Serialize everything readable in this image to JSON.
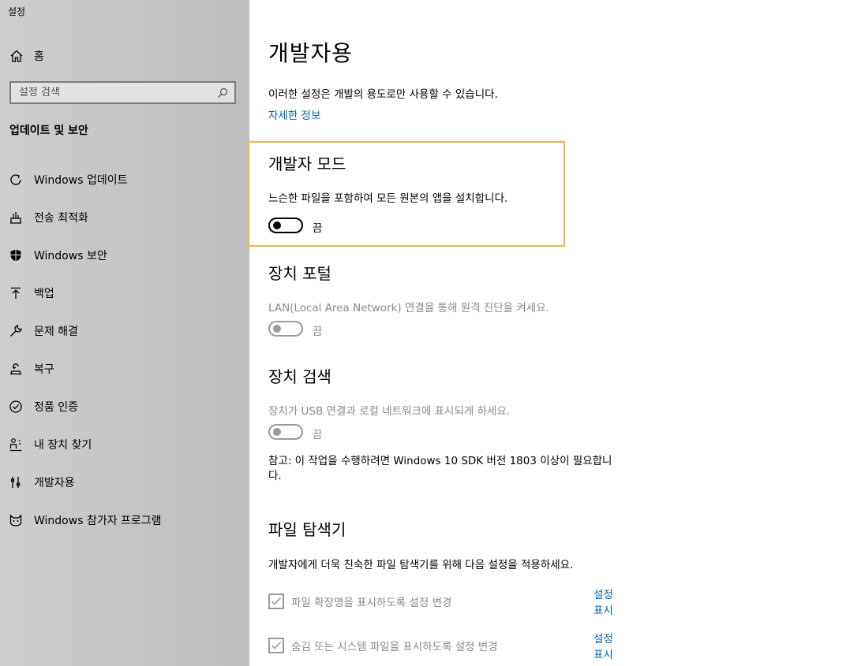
{
  "window": {
    "title": "설정"
  },
  "sidebar": {
    "home_label": "홈",
    "search_placeholder": "설정 검색",
    "section_title": "업데이트 및 보안",
    "items": [
      {
        "label": "Windows 업데이트",
        "icon": "refresh-icon"
      },
      {
        "label": "전송 최적화",
        "icon": "delivery-optimization-icon"
      },
      {
        "label": "Windows 보안",
        "icon": "shield-icon"
      },
      {
        "label": "백업",
        "icon": "backup-arrow-icon"
      },
      {
        "label": "문제 해결",
        "icon": "wrench-icon"
      },
      {
        "label": "복구",
        "icon": "recovery-icon"
      },
      {
        "label": "정품 인증",
        "icon": "check-circle-icon"
      },
      {
        "label": "내 장치 찾기",
        "icon": "person-location-icon"
      },
      {
        "label": "개발자용",
        "icon": "developer-tools-icon"
      },
      {
        "label": "Windows 참가자 프로그램",
        "icon": "insider-cat-icon"
      }
    ]
  },
  "main": {
    "title": "개발자용",
    "description": "이러한 설정은 개발의 용도로만 사용할 수 있습니다.",
    "more_info_link": "자세한 정보",
    "developer_mode": {
      "heading": "개발자 모드",
      "description": "느슨한 파일을 포함하여 모든 원본의 앱을 설치합니다.",
      "toggle_state": "끔"
    },
    "device_portal": {
      "heading": "장치 포털",
      "description": "LAN(Local Area Network) 연결을 통해 원격 진단을 켜세요.",
      "toggle_state": "끔"
    },
    "device_discovery": {
      "heading": "장치 검색",
      "description": "장치가 USB 연결과 로컬 네트워크에 표시되게 하세요.",
      "toggle_state": "끔",
      "note": "참고: 이 작업을 수행하려면 Windows 10 SDK 버전 1803 이상이 필요합니다."
    },
    "file_explorer": {
      "heading": "파일 탐색기",
      "description": "개발자에게 더욱 친숙한 파일 탐색기를 위해 다음 설정을 적용하세요.",
      "options": [
        {
          "label": "파일 확장명을 표시하도록 설정 변경",
          "link": "설정 표시",
          "checked": true
        },
        {
          "label": "숨김 또는 시스템 파일을 표시하도록 설정 변경",
          "link": "설정 표시",
          "checked": true
        }
      ]
    }
  },
  "colors": {
    "accent_link": "#0063b1",
    "highlight_border": "#f4b04a"
  }
}
